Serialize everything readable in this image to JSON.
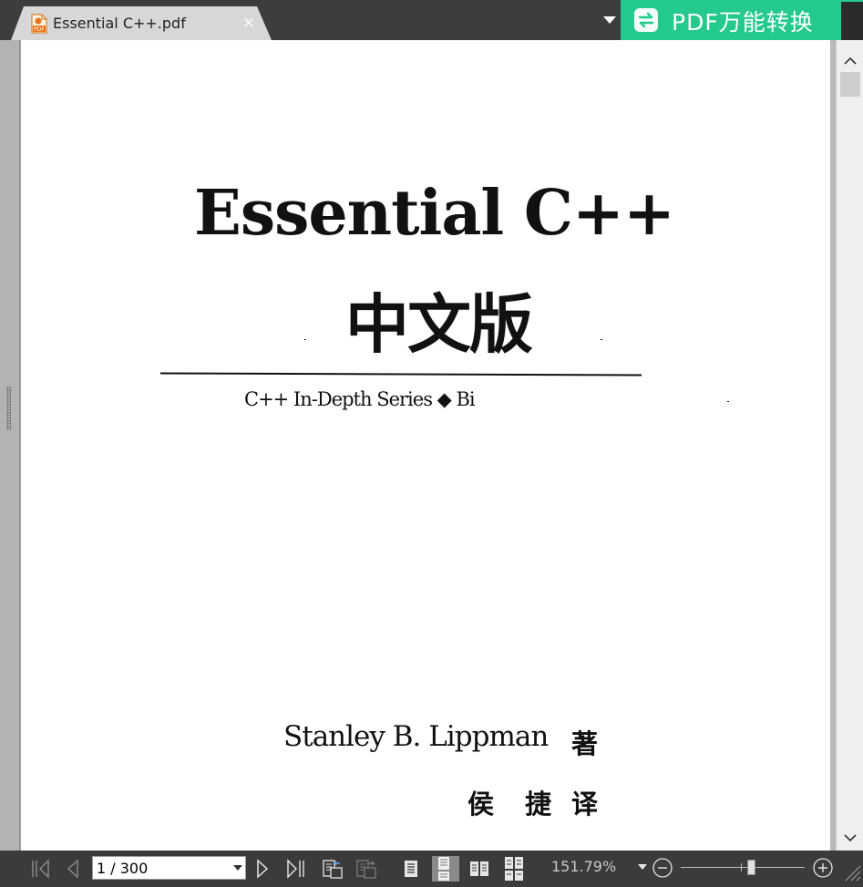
{
  "tab": {
    "title": "Essential C++.pdf",
    "close_label": "×",
    "icon": "pdf-file-icon"
  },
  "promo": {
    "label": "PDF万能转换",
    "icon": "convert-icon",
    "color": "#24c98c"
  },
  "document": {
    "title": "Essential C++",
    "subtitle_cn": "中文版",
    "series": "C++ In-Depth Series ◆ Bi",
    "author": "Stanley B. Lippman",
    "author_role": "著",
    "translator": "侯 捷",
    "translator_role": "译"
  },
  "toolbar": {
    "page_indicator": "1 / 300",
    "zoom_level": "151.79%",
    "icons": [
      "first-page-icon",
      "prev-page-icon",
      "next-page-icon",
      "last-page-icon",
      "prev-view-icon",
      "next-view-icon",
      "single-page-icon",
      "continuous-page-icon",
      "facing-pages-icon",
      "continuous-facing-icon",
      "zoom-out-icon",
      "zoom-in-icon"
    ]
  }
}
